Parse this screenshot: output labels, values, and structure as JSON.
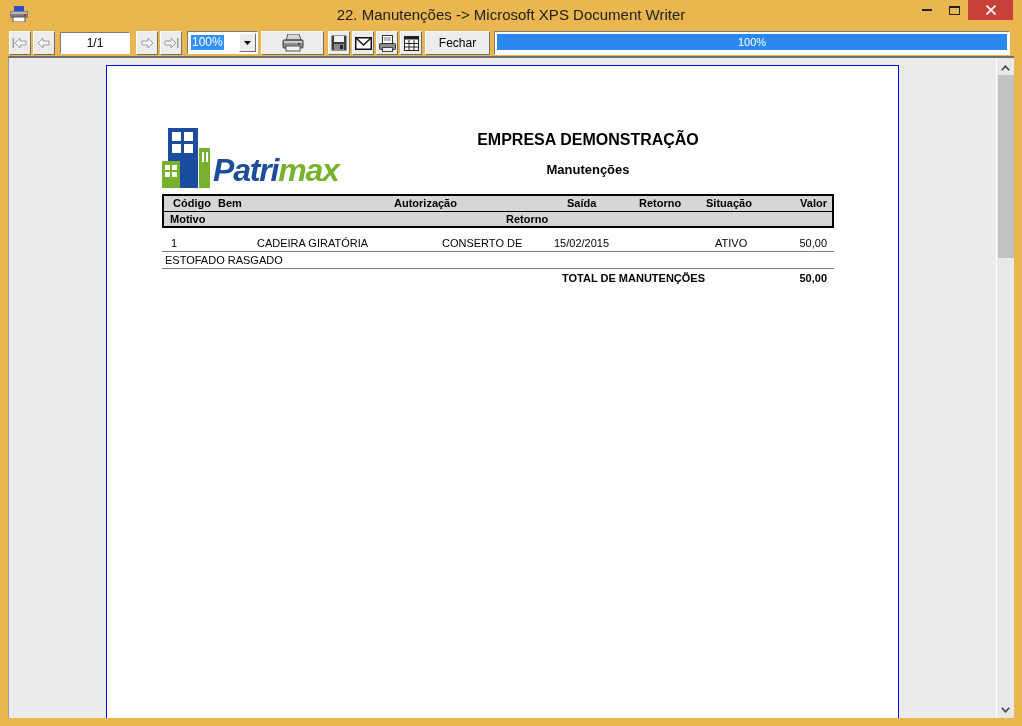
{
  "window": {
    "title": "22. Manutenções -> Microsoft XPS Document Writer"
  },
  "toolbar": {
    "items": [
      {
        "kind": "first",
        "disabled": true
      },
      {
        "kind": "previous",
        "disabled": true
      },
      {
        "kind": "page",
        "value": "1/1"
      },
      {
        "kind": "next",
        "disabled": true
      },
      {
        "kind": "last",
        "disabled": true
      },
      {
        "kind": "zoom",
        "value": "100%",
        "text_selected": true
      },
      {
        "kind": "print"
      },
      {
        "kind": "save"
      },
      {
        "kind": "email"
      },
      {
        "kind": "export"
      },
      {
        "kind": "setup"
      },
      {
        "kind": "button",
        "label": "Fechar"
      },
      {
        "kind": "progress",
        "level": 1,
        "reading": "100%"
      }
    ]
  },
  "report": {
    "logo": [
      {
        "text": "Patri",
        "color": "#1b4c9e"
      },
      {
        "text": "max",
        "color": "#78b22c"
      }
    ],
    "company": "EMPRESA DEMONSTRAÇÃO",
    "title": "Manutenções",
    "columns": [
      "Código",
      "Bem",
      "Autorização",
      "Saída",
      "Retorno",
      "Situação",
      "Valor"
    ],
    "sub_columns": [
      "Motivo",
      "Retorno"
    ],
    "rows": [
      {
        "code": "1",
        "item": "CADEIRA GIRATÓRIA",
        "authorization": "CONSERTO DE",
        "exit_date": "15/02/2015",
        "status": "ATIVO",
        "value": "50,00",
        "reason": "ESTOFADO RASGADO"
      }
    ],
    "total": {
      "label": "TOTAL DE MANUTENÇÕES",
      "value": "50,00"
    }
  }
}
